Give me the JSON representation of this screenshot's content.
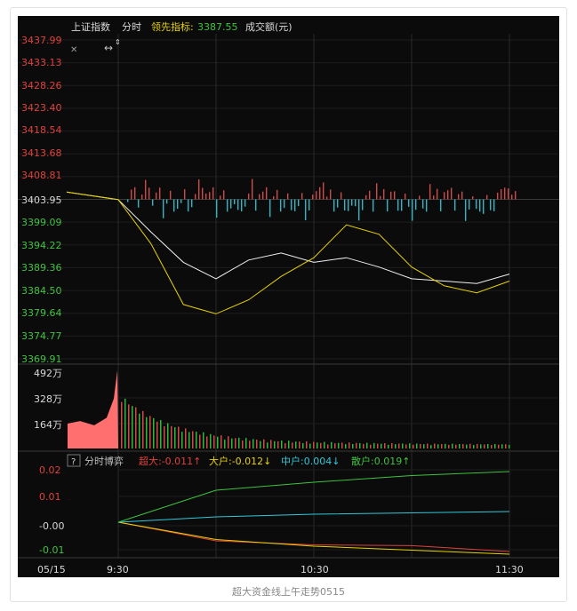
{
  "header": {
    "index_name": "上证指数",
    "mode": "分时",
    "leading_label": "领先指标:",
    "leading_value": "3387.55",
    "volume_label": "成交额(元)"
  },
  "toolbar": {
    "close_glyph": "✕",
    "expand_glyph": "↔"
  },
  "price_axis": [
    "3437.99",
    "3433.13",
    "3428.26",
    "3423.40",
    "3418.54",
    "3413.68",
    "3408.81",
    "3403.95",
    "3399.09",
    "3394.22",
    "3389.36",
    "3384.50",
    "3379.64",
    "3374.77",
    "3369.91"
  ],
  "volume_axis": [
    "492万",
    "328万",
    "164万"
  ],
  "flow_header": {
    "help": "?",
    "title": "分时博弈",
    "super_large": "超大:-0.011↑",
    "large": "大户:-0.012↓",
    "medium": "中户:0.004↓",
    "retail": "散户:0.019↑"
  },
  "flow_axis": [
    "0.02",
    "0.01",
    "-0.00",
    "-0.01"
  ],
  "time_axis": [
    "05/15",
    "9:30",
    "10:30",
    "11:30"
  ],
  "caption": "超大资金线上午走势0515",
  "colors": {
    "price_red": "#e0413b",
    "price_green": "#3fc33f",
    "header_yellow": "#e6d200",
    "accent_cyan": "#2fc8d8",
    "background": "#0b0b0b"
  },
  "chart_data": [
    {
      "type": "line",
      "series": [
        {
          "x": [
            "9:30",
            "9:40",
            "9:50",
            "10:00",
            "10:10",
            "10:20",
            "10:30",
            "10:40",
            "10:50",
            "11:00",
            "11:10",
            "11:20",
            "11:30"
          ],
          "values": [
            3403.9,
            3397,
            3390.5,
            3387,
            3391,
            3392.5,
            3390.5,
            3391.5,
            3389.5,
            3387,
            3386.5,
            3386,
            3388
          ]
        },
        {
          "x": [
            "9:30",
            "9:40",
            "9:50",
            "10:00",
            "10:10",
            "10:20",
            "10:30",
            "10:40",
            "10:50",
            "11:00",
            "11:10",
            "11:20",
            "11:30"
          ],
          "values": [
            3403.9,
            3394.5,
            3381.5,
            3379.5,
            3382.5,
            3387.5,
            3391.5,
            3398.5,
            3396.5,
            3389.5,
            3385.5,
            3384,
            3386.5
          ]
        }
      ],
      "ylim": [
        3369.91,
        3437.99
      ]
    },
    {
      "type": "bar",
      "ylim": [
        0,
        492
      ]
    },
    {
      "type": "line",
      "series": [
        {
          "name": "超大",
          "x": [
            "9:30",
            "10:00",
            "10:30",
            "11:00",
            "11:30"
          ],
          "values": [
            0.0,
            -0.007,
            -0.0085,
            -0.0088,
            -0.011
          ]
        },
        {
          "name": "大户",
          "x": [
            "9:30",
            "10:00",
            "10:30",
            "11:00",
            "11:30"
          ],
          "values": [
            0.0,
            -0.0065,
            -0.009,
            -0.0105,
            -0.012
          ]
        },
        {
          "name": "中户",
          "x": [
            "9:30",
            "10:00",
            "10:30",
            "11:00",
            "11:30"
          ],
          "values": [
            0.0,
            0.002,
            0.003,
            0.0035,
            0.004
          ]
        },
        {
          "name": "散户",
          "x": [
            "9:30",
            "10:00",
            "10:30",
            "11:00",
            "11:30"
          ],
          "values": [
            0.0,
            0.012,
            0.015,
            0.0175,
            0.019
          ]
        }
      ],
      "ylim": [
        -0.01,
        0.02
      ]
    }
  ]
}
